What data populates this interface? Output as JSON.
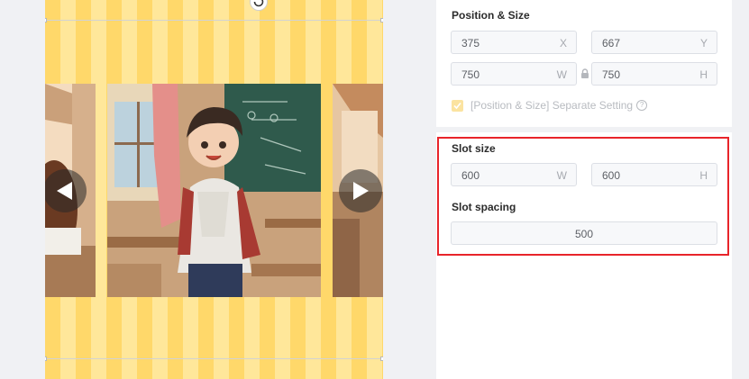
{
  "canvas": {
    "prev_arrow": "prev-arrow",
    "next_arrow": "next-arrow"
  },
  "panel": {
    "position_size": {
      "title": "Position & Size",
      "x": {
        "value": "375",
        "suffix": "X"
      },
      "y": {
        "value": "667",
        "suffix": "Y"
      },
      "w": {
        "value": "750",
        "suffix": "W"
      },
      "h": {
        "value": "750",
        "suffix": "H"
      },
      "separate_setting_label": "[Position & Size] Separate Setting",
      "separate_setting_checked": true
    },
    "slot_size": {
      "title": "Slot size",
      "w": {
        "value": "600",
        "suffix": "W"
      },
      "h": {
        "value": "600",
        "suffix": "H"
      }
    },
    "slot_spacing": {
      "title": "Slot spacing",
      "value": "500"
    }
  },
  "colors": {
    "highlight": "#e8242a",
    "checkbox": "#fbe3a0",
    "canvas_stripe_a": "#ffd86a",
    "canvas_stripe_b": "#ffe79a"
  }
}
